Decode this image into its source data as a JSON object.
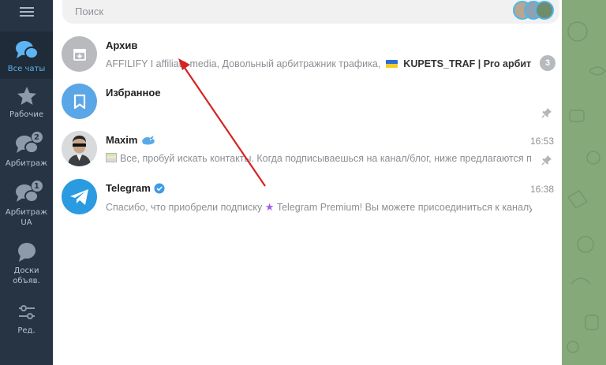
{
  "search": {
    "placeholder": "Поиск"
  },
  "folders": [
    {
      "label": "Все чаты",
      "icon": "chats-icon",
      "active": true
    },
    {
      "label": "Рабочие",
      "icon": "star-icon"
    },
    {
      "label": "Арбитраж",
      "icon": "chats-icon",
      "badge": "2"
    },
    {
      "label": "Арбитраж UA",
      "icon": "chats-icon",
      "badge": "1"
    },
    {
      "label": "Доски объяв.",
      "icon": "chat-bubble-icon"
    },
    {
      "label": "Ред.",
      "icon": "sliders-icon"
    }
  ],
  "chats": [
    {
      "name": "Архив",
      "preview_a": "AFFILIFY I affiliate media, Довольный арбитражник трафика,",
      "preview_b": "KUPETS_TRAF | Pro арбитраж",
      "count": "3"
    },
    {
      "name": "Избранное",
      "pinned": true
    },
    {
      "name": "Maxim",
      "time": "16:53",
      "preview": "Все, пробуй искать контакты.  Когда подписываешься на канал/блог, ниже предлагаются похожие",
      "pinned": true
    },
    {
      "name": "Telegram",
      "time": "16:38",
      "preview_a": "Спасибо, что приобрели подписку",
      "preview_b": "Telegram Premium! Вы можете присоединиться к каналу"
    }
  ],
  "colors": {
    "sidebar": "#263444",
    "accent": "#5fb3f3",
    "annotation_arrow": "#d42424",
    "wallpaper": "#86a97a"
  }
}
